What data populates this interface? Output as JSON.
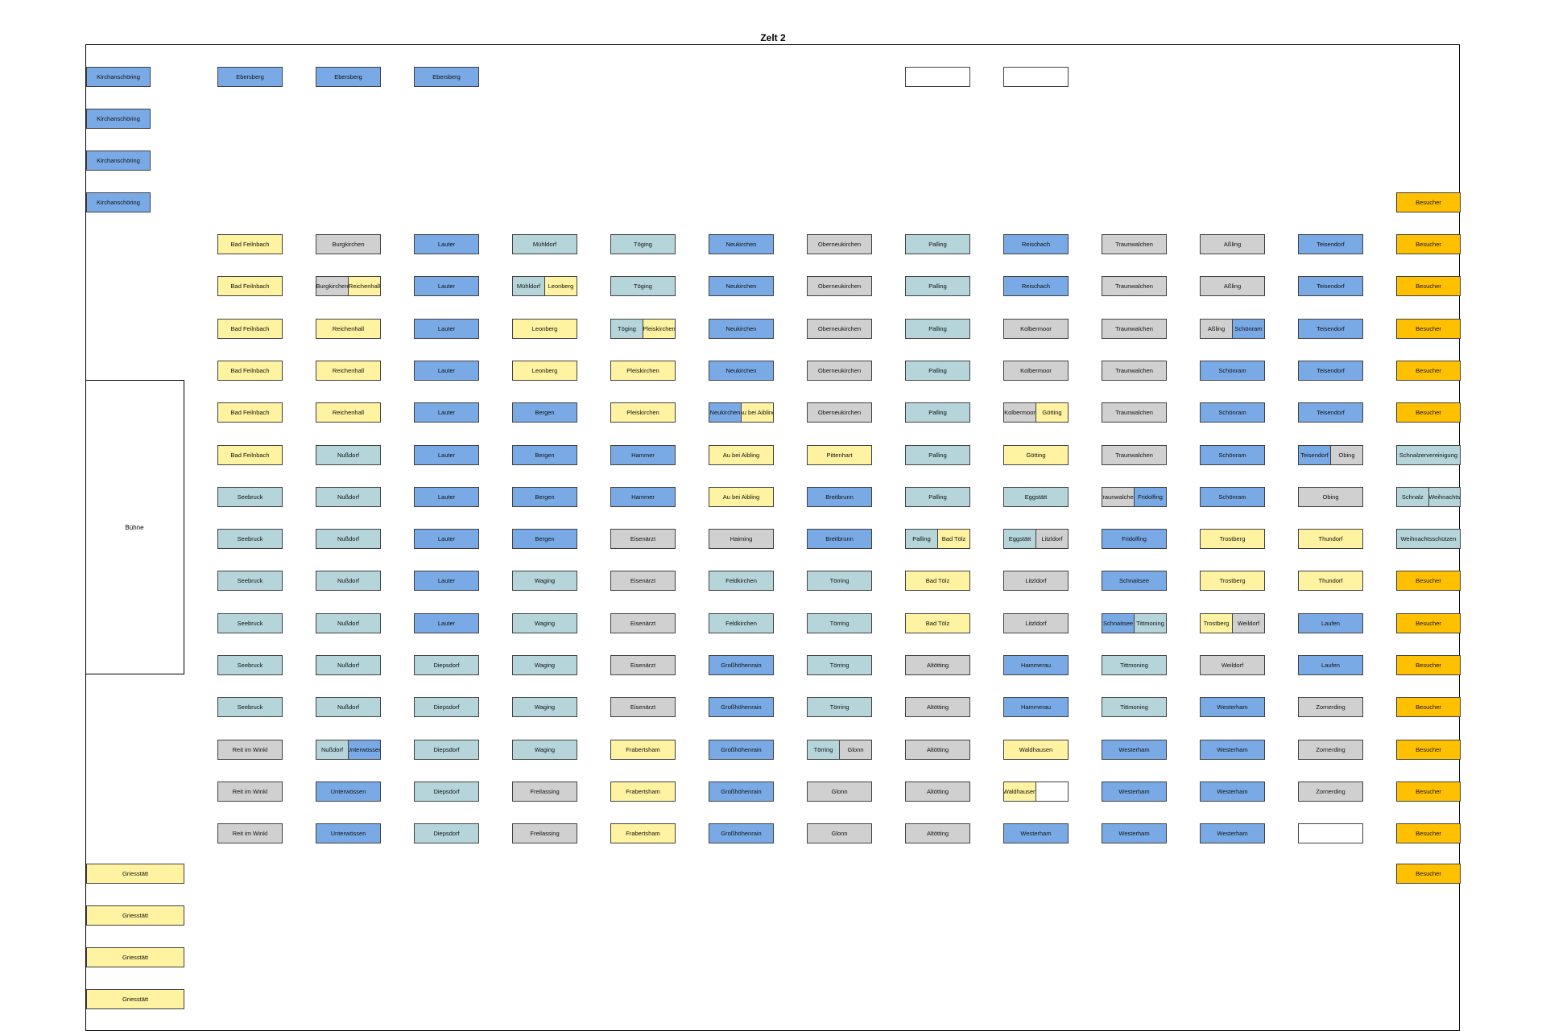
{
  "title": "Zelt 2",
  "stage_label": "Bühne",
  "colors": {
    "blue": "#7aaae6",
    "gray": "#d0d0d0",
    "teal": "#b5d5db",
    "yellow": "#fff2a0",
    "orange": "#ffc000",
    "white": "#ffffff"
  },
  "grid": {
    "rows": [
      [
        "Bad Feilnbach",
        "Burgkirchen",
        "Lauter",
        "Mühldorf",
        "Töging",
        "Neukirchen",
        "Oberneukirchen",
        "Palling",
        "Reischach",
        "Traunwalchen",
        "Aßling",
        "Teisendorf",
        "Besucher"
      ],
      [
        "Bad Feilnbach",
        "Burgkirchen|Reichenhall",
        "Lauter",
        "Mühldorf|Leonberg",
        "Töging",
        "Neukirchen",
        "Oberneukirchen",
        "Palling",
        "Reischach",
        "Traunwalchen",
        "Aßling",
        "Teisendorf",
        "Besucher"
      ],
      [
        "Bad Feilnbach",
        "Reichenhall",
        "Lauter",
        "Leonberg",
        "Töging|Pleiskirchen",
        "Neukirchen",
        "Oberneukirchen",
        "Palling",
        "Kolbermoor",
        "Traunwalchen",
        "Aßling|Schönram",
        "Teisendorf",
        "Besucher"
      ],
      [
        "Bad Feilnbach",
        "Reichenhall",
        "Lauter",
        "Leonberg",
        "Pleiskirchen",
        "Neukirchen",
        "Oberneukirchen",
        "Palling",
        "Kolbermoor",
        "Traunwalchen",
        "Schönram",
        "Teisendorf",
        "Besucher"
      ],
      [
        "Bad Feilnbach",
        "Reichenhall",
        "Lauter",
        "Bergen",
        "Pleiskirchen",
        "Neukirchen|Au bei Aibling",
        "Oberneukirchen",
        "Palling",
        "Kolbermoor|Götting",
        "Traunwalchen",
        "Schönram",
        "Teisendorf",
        "Besucher"
      ],
      [
        "Bad Feilnbach",
        "Nußdorf",
        "Lauter",
        "Bergen",
        "Hammer",
        "Au bei Aibling",
        "Pittenhart",
        "Palling",
        "Götting",
        "Traunwalchen",
        "Schönram",
        "Teisendorf|Obing",
        "Schnalzervereinigung"
      ],
      [
        "Seebruck",
        "Nußdorf",
        "Lauter",
        "Bergen",
        "Hammer",
        "Au bei Aibling",
        "Breitbrunn",
        "Palling",
        "Eggstätt",
        "Traunwalchen|Fridolfing",
        "Schönram",
        "Obing",
        "Schnalz|Weihnachts"
      ],
      [
        "Seebruck",
        "Nußdorf",
        "Lauter",
        "Bergen",
        "Eisenärzt",
        "Haiming",
        "Breitbrunn",
        "Palling|Bad Tölz",
        "Eggstätt|Litzldorf",
        "Fridolfing",
        "Trostberg",
        "Thundorf",
        "Weihnachtsschützen"
      ],
      [
        "Seebruck",
        "Nußdorf",
        "Lauter",
        "Waging",
        "Eisenärzt",
        "Feldkirchen",
        "Törring",
        "Bad Tölz",
        "Litzldorf",
        "Schnaitsee",
        "Trostberg",
        "Thundorf",
        "Besucher"
      ],
      [
        "Seebruck",
        "Nußdorf",
        "Lauter",
        "Waging",
        "Eisenärzt",
        "Feldkirchen",
        "Törring",
        "Bad Tölz",
        "Litzldorf",
        "Schnaitsee|Tittmoning",
        "Trostberg|Weildorf",
        "Laufen",
        "Besucher"
      ],
      [
        "Seebruck",
        "Nußdorf",
        "Diepsdorf",
        "Waging",
        "Eisenärzt",
        "Großhöhenrain",
        "Törring",
        "Altötting",
        "Hammerau",
        "Tittmoning",
        "Weildorf",
        "Laufen",
        "Besucher"
      ],
      [
        "Seebruck",
        "Nußdorf",
        "Diepsdorf",
        "Waging",
        "Eisenärzt",
        "Großhöhenrain",
        "Törring",
        "Altötting",
        "Hammerau",
        "Tittmoning",
        "Westerham",
        "Zornerding",
        "Besucher"
      ],
      [
        "Reit im Winkl",
        "Nußdorf|Unterwössen",
        "Diepsdorf",
        "Waging",
        "Frabertsham",
        "Großhöhenrain",
        "Törring|Glonn",
        "Altötting",
        "Waldhausen",
        "Westerham",
        "Westerham",
        "Zornerding",
        "Besucher"
      ],
      [
        "Reit im Winkl",
        "Unterwössen",
        "Diepsdorf",
        "Freilassing",
        "Frabertsham",
        "Großhöhenrain",
        "Glonn",
        "Altötting",
        "Waldhausen|",
        "Westerham",
        "Westerham",
        "Zornerding",
        "Besucher"
      ],
      [
        "Reit im Winkl",
        "Unterwössen",
        "Diepsdorf",
        "Freilassing",
        "Frabertsham",
        "Großhöhenrain",
        "Glonn",
        "Altötting",
        "Westerham",
        "Westerham",
        "Westerham",
        "",
        "Besucher"
      ]
    ],
    "colors": [
      [
        "yellow",
        "gray",
        "blue",
        "teal",
        "teal",
        "blue",
        "gray",
        "teal",
        "blue",
        "gray",
        "gray",
        "blue",
        "orange"
      ],
      [
        "yellow",
        "gray|yellow",
        "blue",
        "teal|yellow",
        "teal",
        "blue",
        "gray",
        "teal",
        "blue",
        "gray",
        "gray",
        "blue",
        "orange"
      ],
      [
        "yellow",
        "yellow",
        "blue",
        "yellow",
        "teal|yellow",
        "blue",
        "gray",
        "teal",
        "gray",
        "gray",
        "gray|blue",
        "blue",
        "orange"
      ],
      [
        "yellow",
        "yellow",
        "blue",
        "yellow",
        "yellow",
        "blue",
        "gray",
        "teal",
        "gray",
        "gray",
        "blue",
        "blue",
        "orange"
      ],
      [
        "yellow",
        "yellow",
        "blue",
        "blue",
        "yellow",
        "blue|yellow",
        "gray",
        "teal",
        "gray|yellow",
        "gray",
        "blue",
        "blue",
        "orange"
      ],
      [
        "yellow",
        "teal",
        "blue",
        "blue",
        "blue",
        "yellow",
        "yellow",
        "teal",
        "yellow",
        "gray",
        "blue",
        "blue|gray",
        "teal"
      ],
      [
        "teal",
        "teal",
        "blue",
        "blue",
        "blue",
        "yellow",
        "blue",
        "teal",
        "teal",
        "gray|blue",
        "blue",
        "gray",
        "teal|teal"
      ],
      [
        "teal",
        "teal",
        "blue",
        "blue",
        "gray",
        "gray",
        "blue",
        "teal|yellow",
        "teal|gray",
        "blue",
        "yellow",
        "yellow",
        "teal"
      ],
      [
        "teal",
        "teal",
        "blue",
        "teal",
        "gray",
        "teal",
        "teal",
        "yellow",
        "gray",
        "blue",
        "yellow",
        "yellow",
        "orange"
      ],
      [
        "teal",
        "teal",
        "blue",
        "teal",
        "gray",
        "teal",
        "teal",
        "yellow",
        "gray",
        "blue|teal",
        "yellow|gray",
        "blue",
        "orange"
      ],
      [
        "teal",
        "teal",
        "teal",
        "teal",
        "gray",
        "blue",
        "teal",
        "gray",
        "blue",
        "teal",
        "gray",
        "blue",
        "orange"
      ],
      [
        "teal",
        "teal",
        "teal",
        "teal",
        "gray",
        "blue",
        "teal",
        "gray",
        "blue",
        "teal",
        "blue",
        "gray",
        "orange"
      ],
      [
        "gray",
        "teal|blue",
        "teal",
        "teal",
        "yellow",
        "blue",
        "teal|gray",
        "gray",
        "yellow",
        "blue",
        "blue",
        "gray",
        "orange"
      ],
      [
        "gray",
        "blue",
        "teal",
        "gray",
        "yellow",
        "blue",
        "gray",
        "gray",
        "yellow|white",
        "blue",
        "blue",
        "gray",
        "orange"
      ],
      [
        "gray",
        "blue",
        "teal",
        "gray",
        "yellow",
        "blue",
        "gray",
        "gray",
        "blue",
        "blue",
        "blue",
        "white",
        "orange"
      ]
    ]
  },
  "top_row": [
    {
      "label": "Kirchanschöring",
      "color": "blue"
    },
    {
      "label": "Ebersberg",
      "color": "blue"
    },
    {
      "label": "Ebersberg",
      "color": "blue"
    },
    {
      "label": "Ebersberg",
      "color": "blue"
    },
    {
      "label": "",
      "color": "white"
    },
    {
      "label": "",
      "color": "white"
    }
  ],
  "left_column": [
    {
      "label": "Kirchanschöring",
      "color": "blue"
    },
    {
      "label": "Kirchanschöring",
      "color": "blue"
    },
    {
      "label": "Kirchanschöring",
      "color": "blue"
    }
  ],
  "right_top": {
    "label": "Besucher",
    "color": "orange"
  },
  "right_bottom": {
    "label": "Besucher",
    "color": "orange"
  },
  "bottom_left": [
    {
      "label": "Griesstätt",
      "color": "yellow"
    },
    {
      "label": "Griesstätt",
      "color": "yellow"
    },
    {
      "label": "Griesstätt",
      "color": "yellow"
    },
    {
      "label": "Griesstätt",
      "color": "yellow"
    }
  ]
}
